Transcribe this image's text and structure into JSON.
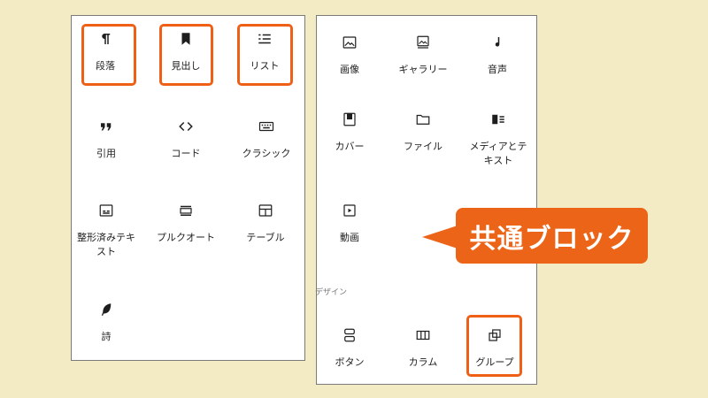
{
  "left_panel": {
    "blocks": [
      {
        "label": "段落",
        "icon": "pilcrow-icon"
      },
      {
        "label": "見出し",
        "icon": "bookmark-icon"
      },
      {
        "label": "リスト",
        "icon": "list-icon"
      },
      {
        "label": "引用",
        "icon": "quote-icon"
      },
      {
        "label": "コード",
        "icon": "code-icon"
      },
      {
        "label": "クラシック",
        "icon": "keyboard-icon"
      },
      {
        "label": "整形済みテキスト",
        "icon": "preformatted-icon"
      },
      {
        "label": "プルクオート",
        "icon": "pullquote-icon"
      },
      {
        "label": "テーブル",
        "icon": "table-icon"
      },
      {
        "label": "詩",
        "icon": "feather-icon"
      }
    ]
  },
  "right_panel": {
    "blocks": [
      {
        "label": "画像",
        "icon": "image-icon"
      },
      {
        "label": "ギャラリー",
        "icon": "gallery-icon"
      },
      {
        "label": "音声",
        "icon": "audio-icon"
      },
      {
        "label": "カバー",
        "icon": "cover-icon"
      },
      {
        "label": "ファイル",
        "icon": "folder-icon"
      },
      {
        "label": "メディアとテキスト",
        "icon": "media-text-icon"
      },
      {
        "label": "動画",
        "icon": "video-icon"
      }
    ],
    "section_label": "デザイン",
    "design_blocks": [
      {
        "label": "ボタン",
        "icon": "buttons-icon"
      },
      {
        "label": "カラム",
        "icon": "columns-icon"
      },
      {
        "label": "グループ",
        "icon": "group-icon"
      }
    ]
  },
  "callout": {
    "text": "共通ブロック"
  },
  "colors": {
    "highlight": "#ef5f15",
    "callout": "#ec6417",
    "background": "#f3ebc3"
  }
}
